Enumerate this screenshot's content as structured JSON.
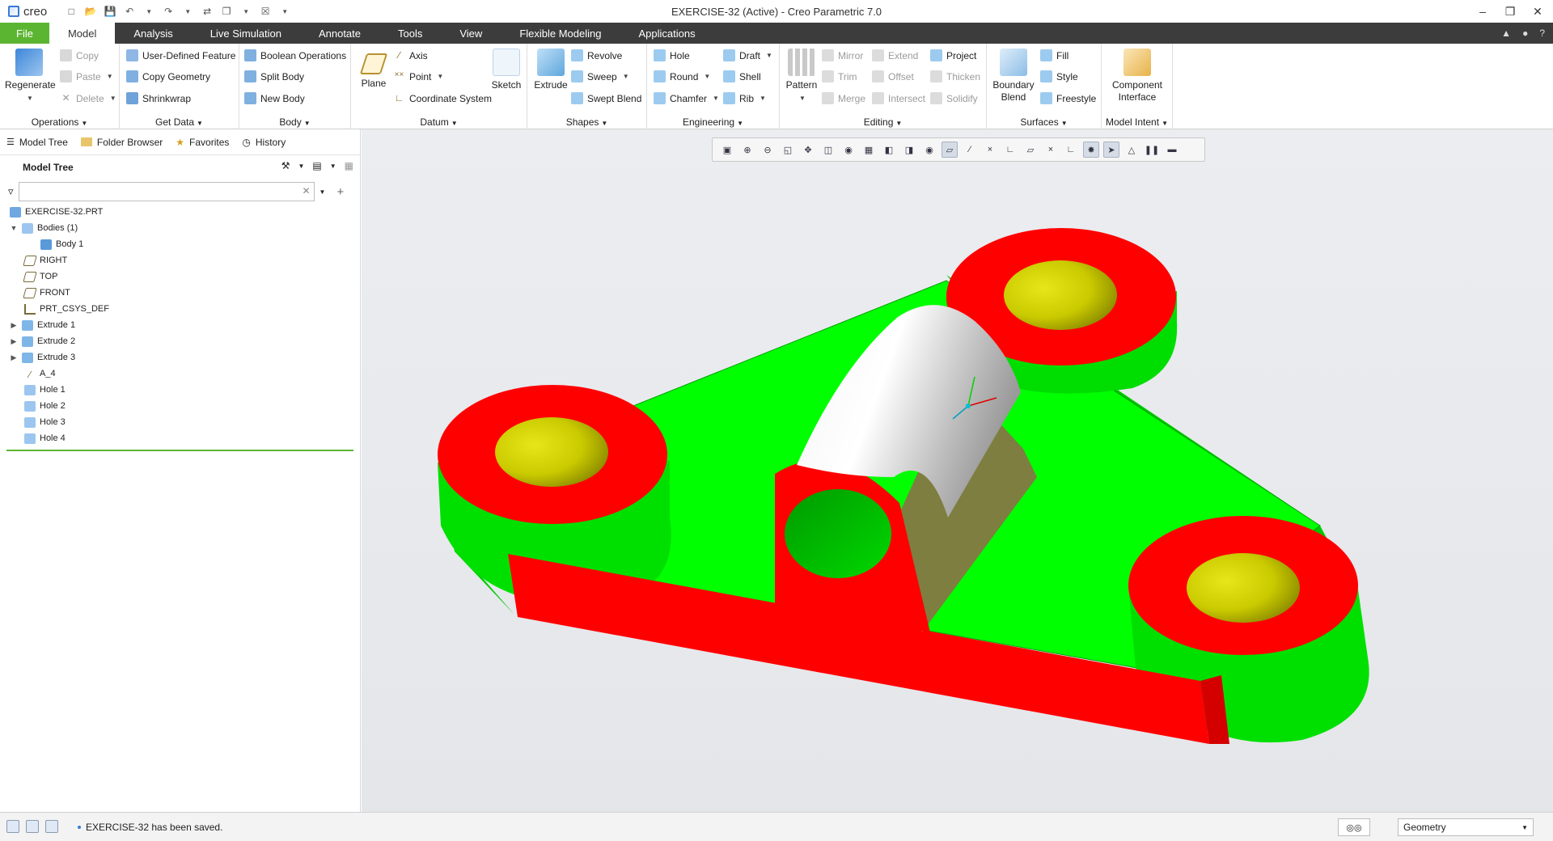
{
  "app": {
    "logo_text": "creo",
    "window_title": "EXERCISE-32 (Active) - Creo Parametric 7.0"
  },
  "tabs": [
    {
      "label": "File"
    },
    {
      "label": "Model"
    },
    {
      "label": "Analysis"
    },
    {
      "label": "Live Simulation"
    },
    {
      "label": "Annotate"
    },
    {
      "label": "Tools"
    },
    {
      "label": "View"
    },
    {
      "label": "Flexible Modeling"
    },
    {
      "label": "Applications"
    }
  ],
  "ribbon": {
    "operations": {
      "regenerate": "Regenerate",
      "copy": "Copy",
      "paste": "Paste",
      "delete": "Delete",
      "label": "Operations"
    },
    "getdata": {
      "udf": "User-Defined Feature",
      "copygeom": "Copy Geometry",
      "shrinkwrap": "Shrinkwrap",
      "label": "Get Data"
    },
    "body": {
      "boolean": "Boolean Operations",
      "split": "Split Body",
      "newbody": "New Body",
      "label": "Body"
    },
    "datum": {
      "plane": "Plane",
      "axis": "Axis",
      "point": "Point",
      "csys": "Coordinate System",
      "sketch": "Sketch",
      "label": "Datum"
    },
    "shapes": {
      "extrude": "Extrude",
      "revolve": "Revolve",
      "sweep": "Sweep",
      "sweptblend": "Swept Blend",
      "label": "Shapes"
    },
    "engineering": {
      "hole": "Hole",
      "round": "Round",
      "chamfer": "Chamfer",
      "draft": "Draft",
      "shell": "Shell",
      "rib": "Rib",
      "label": "Engineering"
    },
    "editing": {
      "pattern": "Pattern",
      "mirror": "Mirror",
      "trim": "Trim",
      "merge": "Merge",
      "extend": "Extend",
      "offset": "Offset",
      "intersect": "Intersect",
      "project": "Project",
      "thicken": "Thicken",
      "solidify": "Solidify",
      "label": "Editing"
    },
    "surfaces": {
      "boundary": "Boundary Blend",
      "fill": "Fill",
      "style": "Style",
      "freestyle": "Freestyle",
      "label": "Surfaces"
    },
    "modelintent": {
      "component": "Component Interface",
      "label": "Model Intent"
    }
  },
  "navtabs": [
    {
      "label": "Model Tree"
    },
    {
      "label": "Folder Browser"
    },
    {
      "label": "Favorites"
    },
    {
      "label": "History"
    }
  ],
  "model_tree": {
    "title": "Model Tree",
    "search_value": "",
    "items": [
      {
        "label": "EXERCISE-32.PRT"
      },
      {
        "label": "Bodies (1)"
      },
      {
        "label": "Body 1"
      },
      {
        "label": "RIGHT"
      },
      {
        "label": "TOP"
      },
      {
        "label": "FRONT"
      },
      {
        "label": "PRT_CSYS_DEF"
      },
      {
        "label": "Extrude 1"
      },
      {
        "label": "Extrude 2"
      },
      {
        "label": "Extrude 3"
      },
      {
        "label": "A_4"
      },
      {
        "label": "Hole 1"
      },
      {
        "label": "Hole 2"
      },
      {
        "label": "Hole 3"
      },
      {
        "label": "Hole 4"
      }
    ]
  },
  "status": {
    "message": "EXERCISE-32 has been saved.",
    "selection_filter": "Geometry"
  },
  "colors": {
    "green": "#00ff00",
    "red": "#ff0000",
    "accent_green": "#5cb531",
    "dark_bar": "#3c3c3c"
  }
}
